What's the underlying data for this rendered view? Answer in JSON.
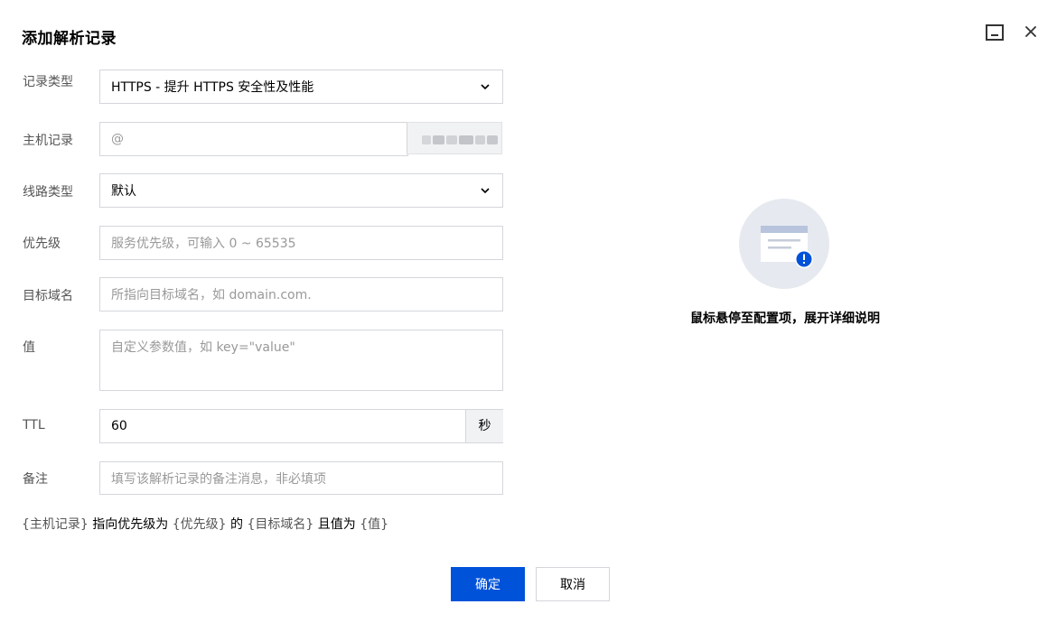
{
  "dialog": {
    "title": "添加解析记录"
  },
  "icons": {
    "minimize": "minimize-window-icon",
    "close": "close-icon",
    "dropdown": "chevron-down-icon",
    "illustration": "info-document-icon"
  },
  "colors": {
    "primary": "#0052d9",
    "border": "#d4d6db",
    "placeholder": "#999999",
    "label": "#555555",
    "suffix_bg": "#f1f2f4"
  },
  "form": {
    "record_type": {
      "label": "记录类型",
      "value": "HTTPS - 提升 HTTPS 安全性及性能"
    },
    "host": {
      "label": "主机记录",
      "placeholder": "@"
    },
    "line_type": {
      "label": "线路类型",
      "value": "默认"
    },
    "priority": {
      "label": "优先级",
      "placeholder": "服务优先级，可输入 0 ~ 65535"
    },
    "target": {
      "label": "目标域名",
      "placeholder": "所指向目标域名，如 domain.com."
    },
    "value_field": {
      "label": "值",
      "placeholder": "自定义参数值，如 key=\"value\""
    },
    "ttl": {
      "label": "TTL",
      "value": "60",
      "unit": "秒"
    },
    "remark": {
      "label": "备注",
      "placeholder": "填写该解析记录的备注消息，非必填项"
    }
  },
  "summary": {
    "host_token": "{主机记录}",
    "text1": "指向优先级为",
    "priority_token": "{优先级}",
    "text2": "的",
    "target_token": "{目标域名}",
    "text3": "且值为",
    "value_token": "{值}"
  },
  "buttons": {
    "ok": "确定",
    "cancel": "取消"
  },
  "hint": {
    "text": "鼠标悬停至配置项，展开详细说明"
  }
}
